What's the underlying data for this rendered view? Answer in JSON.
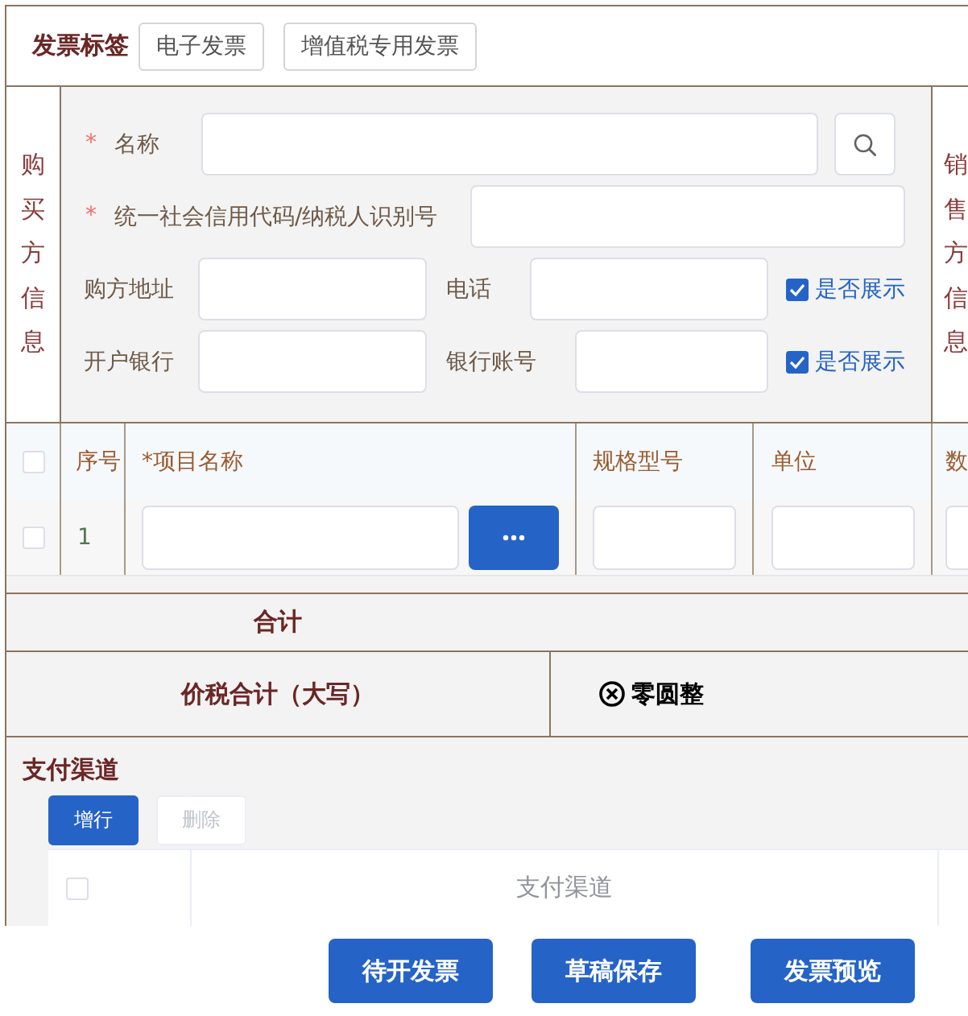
{
  "invoice_tags": {
    "label": "发票标签",
    "options": [
      {
        "label": "电子发票",
        "selected": false
      },
      {
        "label": "增值税专用发票",
        "selected": false
      }
    ]
  },
  "buyer": {
    "title": "购买方信息",
    "rows": [
      {
        "kind": "search",
        "fields": [
          {
            "required_mark": "*",
            "label": "名称"
          }
        ]
      },
      {
        "kind": "wide",
        "fields": [
          {
            "required_mark": "*",
            "label": "统一社会信用代码/纳税人识别号"
          }
        ]
      },
      {
        "kind": "pair",
        "fields": [
          {
            "label": "购方地址"
          },
          {
            "label": "电话"
          }
        ],
        "display": {
          "label": "是否展示",
          "checked": true
        }
      },
      {
        "kind": "pair",
        "fields": [
          {
            "label": "开户银行"
          },
          {
            "label": "银行账号"
          }
        ],
        "display": {
          "label": "是否展示",
          "checked": true
        }
      }
    ]
  },
  "seller": {
    "title": "销售方信息"
  },
  "items_table": {
    "all_checked": false,
    "columns": [
      {
        "label": "序号"
      },
      {
        "label": "*项目名称"
      },
      {
        "label": "规格型号"
      },
      {
        "label": "单位"
      },
      {
        "label": "数"
      }
    ],
    "rows": [
      {
        "index": "1",
        "checked": false
      }
    ]
  },
  "total": {
    "label": "合计"
  },
  "tax_total": {
    "label": "价税合计（大写）",
    "value": "零圆整"
  },
  "payment": {
    "title": "支付渠道",
    "buttons": [
      {
        "label": "增行",
        "disabled": false
      },
      {
        "label": "删除",
        "disabled": true
      }
    ],
    "table": {
      "all_checked": false,
      "columns": [
        {
          "label": "支付渠道"
        }
      ]
    }
  },
  "actions": [
    {
      "label": "待开发票"
    },
    {
      "label": "草稿保存"
    },
    {
      "label": "发票预览"
    }
  ]
}
